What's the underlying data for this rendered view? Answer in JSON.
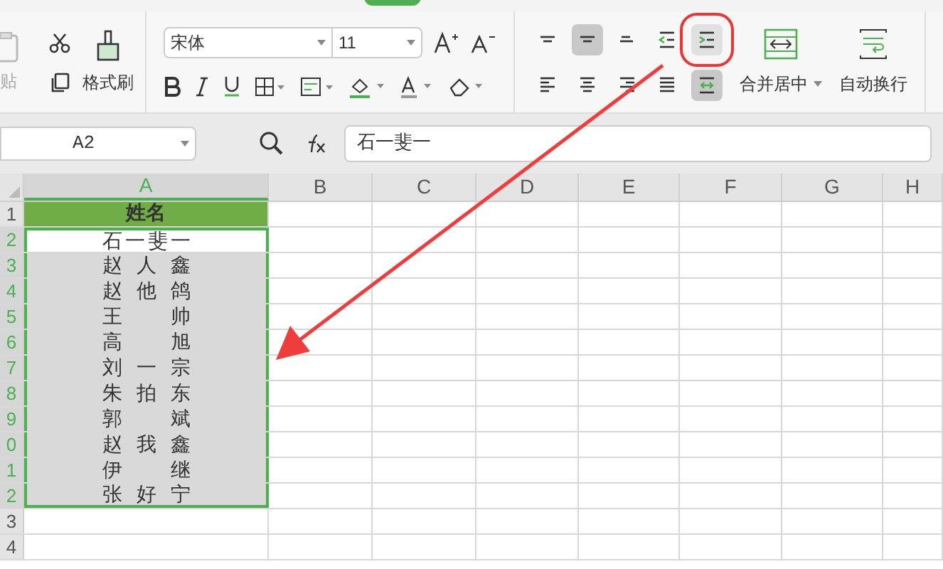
{
  "ribbon": {
    "clipboard": {
      "paste_label": "贴",
      "paste_disabled": true,
      "format_painter_label": "格式刷"
    },
    "font": {
      "name": "宋体",
      "size": "11"
    },
    "alignment": [
      {
        "kind": "top",
        "selected": false,
        "highlighted": false
      },
      {
        "kind": "middle",
        "selected": true,
        "highlighted": false
      },
      {
        "kind": "bottom",
        "selected": false,
        "highlighted": false
      },
      {
        "kind": "outdent",
        "selected": false,
        "highlighted": false
      },
      {
        "kind": "indent",
        "selected": false,
        "highlighted": true
      },
      {
        "kind": "left",
        "selected": false,
        "highlighted": false
      },
      {
        "kind": "center",
        "selected": false,
        "highlighted": false
      },
      {
        "kind": "right",
        "selected": false,
        "highlighted": false
      },
      {
        "kind": "justify",
        "selected": false,
        "highlighted": false
      },
      {
        "kind": "distributed",
        "selected": true,
        "highlighted": false
      }
    ],
    "merge_label": "合并居中",
    "wrap_label": "自动换行"
  },
  "formula_bar": {
    "name_box": "A2",
    "formula": "石一斐一"
  },
  "sheet": {
    "columns": [
      {
        "label": "A",
        "selected": true
      },
      {
        "label": "B",
        "selected": false
      },
      {
        "label": "C",
        "selected": false
      },
      {
        "label": "D",
        "selected": false
      },
      {
        "label": "E",
        "selected": false
      },
      {
        "label": "F",
        "selected": false
      },
      {
        "label": "G",
        "selected": false
      },
      {
        "label": "H",
        "selected": false
      }
    ],
    "rows": [
      {
        "number": "1",
        "value": "姓名",
        "kind": "header",
        "selected": false
      },
      {
        "number": "2",
        "value": "石一斐一",
        "kind": "name",
        "selected": true
      },
      {
        "number": "3",
        "value": "赵人鑫",
        "kind": "name",
        "selected": true
      },
      {
        "number": "4",
        "value": "赵他鸽",
        "kind": "name",
        "selected": true
      },
      {
        "number": "5",
        "value": "王帅",
        "kind": "name",
        "selected": true
      },
      {
        "number": "6",
        "value": "高旭",
        "kind": "name",
        "selected": true
      },
      {
        "number": "7",
        "value": "刘一宗",
        "kind": "name",
        "selected": true
      },
      {
        "number": "8",
        "value": "朱拍东",
        "kind": "name",
        "selected": true
      },
      {
        "number": "9",
        "value": "郭斌",
        "kind": "name",
        "selected": true
      },
      {
        "number": "0",
        "value": "赵我鑫",
        "kind": "name",
        "selected": true
      },
      {
        "number": "1",
        "value": "伊继",
        "kind": "name",
        "selected": true
      },
      {
        "number": "2",
        "value": "张好宁",
        "kind": "name",
        "selected": true
      },
      {
        "number": "3",
        "kind": "empty",
        "selected": false
      },
      {
        "number": "4",
        "kind": "empty",
        "selected": false
      }
    ]
  }
}
